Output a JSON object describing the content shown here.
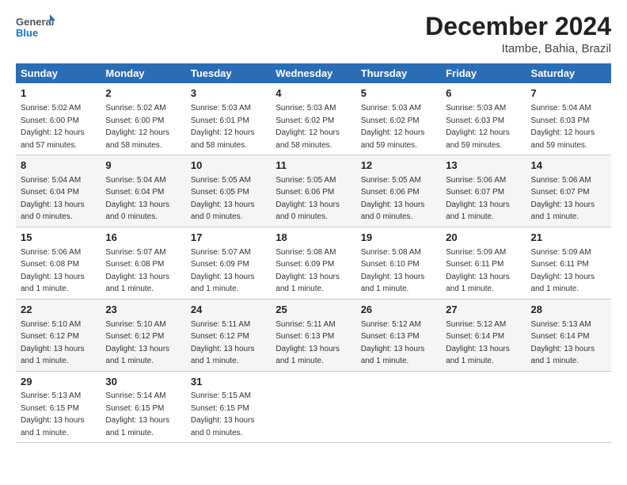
{
  "logo": {
    "general": "General",
    "blue": "Blue"
  },
  "title": "December 2024",
  "location": "Itambe, Bahia, Brazil",
  "days_of_week": [
    "Sunday",
    "Monday",
    "Tuesday",
    "Wednesday",
    "Thursday",
    "Friday",
    "Saturday"
  ],
  "weeks": [
    [
      {
        "day": "1",
        "info": "Sunrise: 5:02 AM\nSunset: 6:00 PM\nDaylight: 12 hours\nand 57 minutes."
      },
      {
        "day": "2",
        "info": "Sunrise: 5:02 AM\nSunset: 6:00 PM\nDaylight: 12 hours\nand 58 minutes."
      },
      {
        "day": "3",
        "info": "Sunrise: 5:03 AM\nSunset: 6:01 PM\nDaylight: 12 hours\nand 58 minutes."
      },
      {
        "day": "4",
        "info": "Sunrise: 5:03 AM\nSunset: 6:02 PM\nDaylight: 12 hours\nand 58 minutes."
      },
      {
        "day": "5",
        "info": "Sunrise: 5:03 AM\nSunset: 6:02 PM\nDaylight: 12 hours\nand 59 minutes."
      },
      {
        "day": "6",
        "info": "Sunrise: 5:03 AM\nSunset: 6:03 PM\nDaylight: 12 hours\nand 59 minutes."
      },
      {
        "day": "7",
        "info": "Sunrise: 5:04 AM\nSunset: 6:03 PM\nDaylight: 12 hours\nand 59 minutes."
      }
    ],
    [
      {
        "day": "8",
        "info": "Sunrise: 5:04 AM\nSunset: 6:04 PM\nDaylight: 13 hours\nand 0 minutes."
      },
      {
        "day": "9",
        "info": "Sunrise: 5:04 AM\nSunset: 6:04 PM\nDaylight: 13 hours\nand 0 minutes."
      },
      {
        "day": "10",
        "info": "Sunrise: 5:05 AM\nSunset: 6:05 PM\nDaylight: 13 hours\nand 0 minutes."
      },
      {
        "day": "11",
        "info": "Sunrise: 5:05 AM\nSunset: 6:06 PM\nDaylight: 13 hours\nand 0 minutes."
      },
      {
        "day": "12",
        "info": "Sunrise: 5:05 AM\nSunset: 6:06 PM\nDaylight: 13 hours\nand 0 minutes."
      },
      {
        "day": "13",
        "info": "Sunrise: 5:06 AM\nSunset: 6:07 PM\nDaylight: 13 hours\nand 1 minute."
      },
      {
        "day": "14",
        "info": "Sunrise: 5:06 AM\nSunset: 6:07 PM\nDaylight: 13 hours\nand 1 minute."
      }
    ],
    [
      {
        "day": "15",
        "info": "Sunrise: 5:06 AM\nSunset: 6:08 PM\nDaylight: 13 hours\nand 1 minute."
      },
      {
        "day": "16",
        "info": "Sunrise: 5:07 AM\nSunset: 6:08 PM\nDaylight: 13 hours\nand 1 minute."
      },
      {
        "day": "17",
        "info": "Sunrise: 5:07 AM\nSunset: 6:09 PM\nDaylight: 13 hours\nand 1 minute."
      },
      {
        "day": "18",
        "info": "Sunrise: 5:08 AM\nSunset: 6:09 PM\nDaylight: 13 hours\nand 1 minute."
      },
      {
        "day": "19",
        "info": "Sunrise: 5:08 AM\nSunset: 6:10 PM\nDaylight: 13 hours\nand 1 minute."
      },
      {
        "day": "20",
        "info": "Sunrise: 5:09 AM\nSunset: 6:11 PM\nDaylight: 13 hours\nand 1 minute."
      },
      {
        "day": "21",
        "info": "Sunrise: 5:09 AM\nSunset: 6:11 PM\nDaylight: 13 hours\nand 1 minute."
      }
    ],
    [
      {
        "day": "22",
        "info": "Sunrise: 5:10 AM\nSunset: 6:12 PM\nDaylight: 13 hours\nand 1 minute."
      },
      {
        "day": "23",
        "info": "Sunrise: 5:10 AM\nSunset: 6:12 PM\nDaylight: 13 hours\nand 1 minute."
      },
      {
        "day": "24",
        "info": "Sunrise: 5:11 AM\nSunset: 6:12 PM\nDaylight: 13 hours\nand 1 minute."
      },
      {
        "day": "25",
        "info": "Sunrise: 5:11 AM\nSunset: 6:13 PM\nDaylight: 13 hours\nand 1 minute."
      },
      {
        "day": "26",
        "info": "Sunrise: 5:12 AM\nSunset: 6:13 PM\nDaylight: 13 hours\nand 1 minute."
      },
      {
        "day": "27",
        "info": "Sunrise: 5:12 AM\nSunset: 6:14 PM\nDaylight: 13 hours\nand 1 minute."
      },
      {
        "day": "28",
        "info": "Sunrise: 5:13 AM\nSunset: 6:14 PM\nDaylight: 13 hours\nand 1 minute."
      }
    ],
    [
      {
        "day": "29",
        "info": "Sunrise: 5:13 AM\nSunset: 6:15 PM\nDaylight: 13 hours\nand 1 minute."
      },
      {
        "day": "30",
        "info": "Sunrise: 5:14 AM\nSunset: 6:15 PM\nDaylight: 13 hours\nand 1 minute."
      },
      {
        "day": "31",
        "info": "Sunrise: 5:15 AM\nSunset: 6:15 PM\nDaylight: 13 hours\nand 0 minutes."
      },
      null,
      null,
      null,
      null
    ]
  ]
}
